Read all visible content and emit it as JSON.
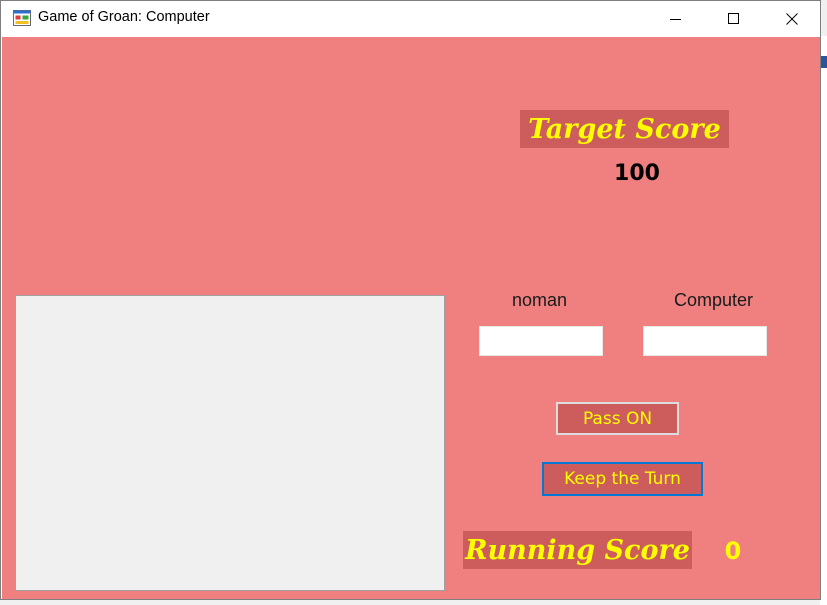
{
  "window": {
    "title": "Game of Groan: Computer",
    "app_icon": "windows-form-icon",
    "controls": [
      "minimize-icon",
      "maximize-icon",
      "close-icon"
    ]
  },
  "game": {
    "target_label": "Target Score",
    "target_value": "100",
    "players": [
      {
        "name": "noman",
        "score_value": ""
      },
      {
        "name": "Computer",
        "score_value": ""
      }
    ],
    "buttons": {
      "pass": "Pass ON",
      "keep": "Keep the Turn"
    },
    "running_label": "Running Score",
    "running_value": "0"
  },
  "colors": {
    "background": "#f08080",
    "label_background": "#cd5c5c",
    "accent_text": "#ffff00",
    "focus_border": "#0078d7"
  }
}
